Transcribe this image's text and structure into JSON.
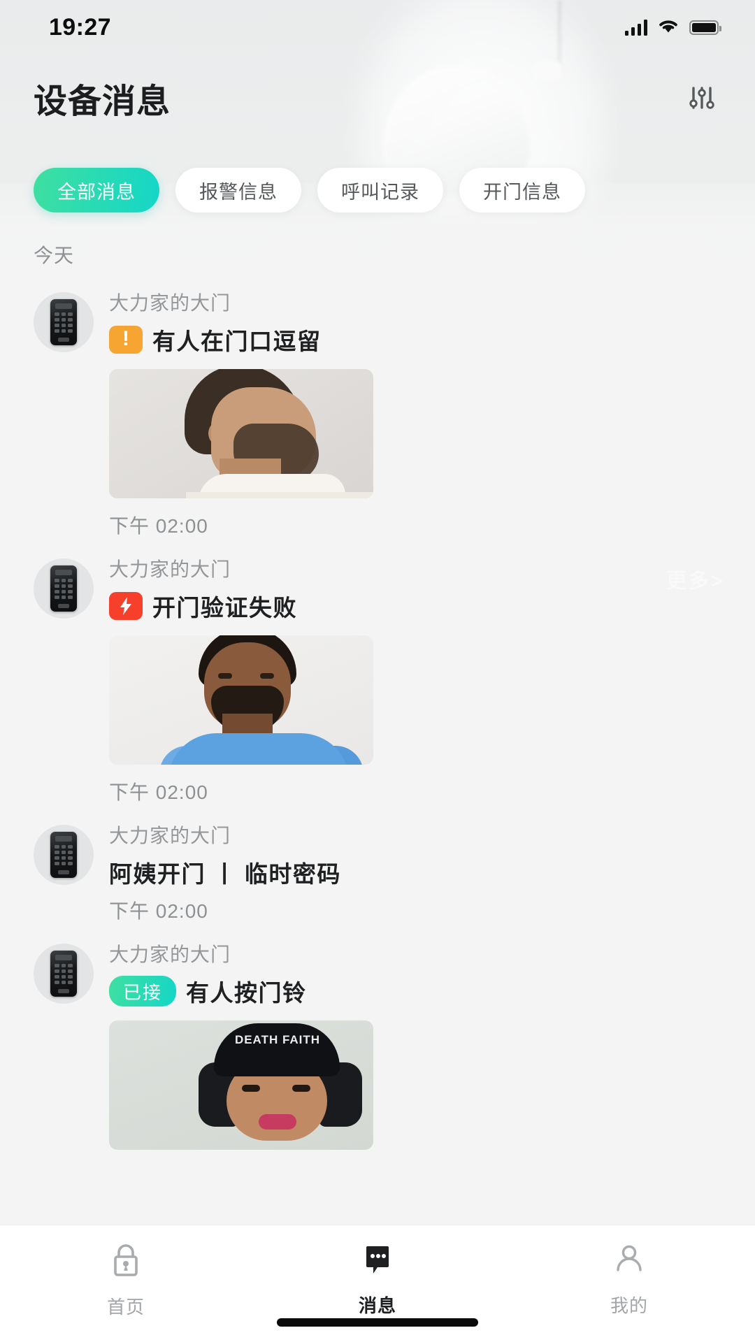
{
  "status_bar": {
    "time": "19:27",
    "icons": {
      "signal": "signal-bars-icon",
      "wifi": "wifi-icon",
      "battery": "battery-full-icon"
    }
  },
  "header": {
    "title": "设备消息",
    "filter_icon": "sliders-filter-icon"
  },
  "filter_tabs": [
    {
      "label": "全部消息",
      "active": true
    },
    {
      "label": "报警信息",
      "active": false
    },
    {
      "label": "呼叫记录",
      "active": false
    },
    {
      "label": "开门信息",
      "active": false
    }
  ],
  "list": {
    "day_label": "今天",
    "more_watermark": "更多>",
    "items": [
      {
        "device": "大力家的大门",
        "badge": {
          "type": "warn",
          "glyph": "!",
          "label": ""
        },
        "title": "有人在门口逗留",
        "time": "下午 02:00",
        "photo": "man-profile-white-turtleneck"
      },
      {
        "device": "大力家的大门",
        "badge": {
          "type": "danger",
          "glyph": "bolt",
          "label": ""
        },
        "title": "开门验证失败",
        "time": "下午 02:00",
        "photo": "man-blue-tshirt"
      },
      {
        "device": "大力家的大门",
        "badge": null,
        "title": "阿姨开门 丨 临时密码",
        "time": "下午 02:00",
        "photo": null
      },
      {
        "device": "大力家的大门",
        "badge": {
          "type": "ok",
          "glyph": "",
          "label": "已接"
        },
        "title": "有人按门铃",
        "time": "",
        "photo": "woman-black-cap"
      }
    ]
  },
  "bottom_nav": [
    {
      "label": "首页",
      "icon": "lock-icon",
      "active": false
    },
    {
      "label": "消息",
      "icon": "chat-bubble-icon",
      "active": true
    },
    {
      "label": "我的",
      "icon": "person-icon",
      "active": false
    }
  ],
  "photo3_cap_text": "DEATH\nFAITH",
  "colors": {
    "accent_start": "#3fdfa0",
    "accent_end": "#14d6c8",
    "warn": "#f6a532",
    "danger": "#f6402c",
    "title_text": "#1e2022",
    "muted_text": "#93979a",
    "page_bg": "#f4f4f4"
  }
}
